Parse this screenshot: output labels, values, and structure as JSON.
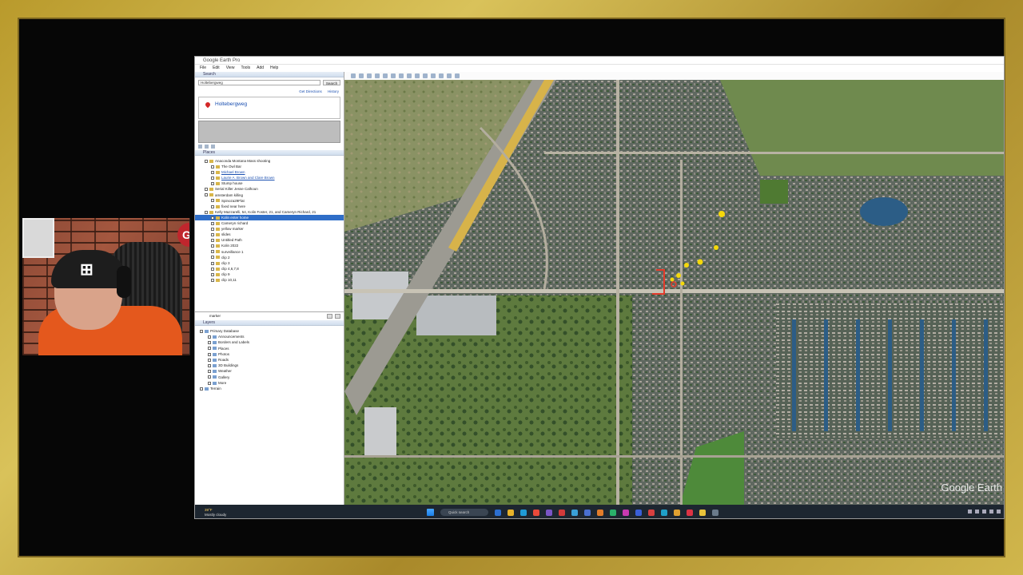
{
  "window": {
    "title": "Google Earth Pro",
    "menu": [
      "File",
      "Edit",
      "View",
      "Tools",
      "Add",
      "Help"
    ]
  },
  "search": {
    "header": "Search",
    "query": "Holtebergweg",
    "button": "Search",
    "get_directions": "Get Directions",
    "history": "History",
    "result": "Holtebergweg"
  },
  "places": {
    "header": "Places",
    "items": [
      {
        "label": "Anaconda Montana Mass shooting",
        "style": "",
        "indent": 1
      },
      {
        "label": "The Owl Bar",
        "style": "",
        "indent": 2
      },
      {
        "label": "Michael Brown",
        "style": "link",
        "indent": 2
      },
      {
        "label": "Laurie A. Brown and Clare Brown",
        "style": "link",
        "indent": 2
      },
      {
        "label": "Stump house",
        "style": "",
        "indent": 2
      },
      {
        "label": "Serial Killer Jesse Calhoun",
        "style": "",
        "indent": 1
      },
      {
        "label": "amsterdam killing",
        "style": "",
        "indent": 1
      },
      {
        "label": "Spinoza29Flat",
        "style": "",
        "indent": 2
      },
      {
        "label": "fixed near here",
        "style": "",
        "indent": 2
      },
      {
        "label": "Kelly Mazzarelli, 54, Kolin Foster, 21, and Cameryn Richard, 21",
        "style": "",
        "indent": 1
      },
      {
        "label": "Kolin enter home",
        "style": "selected",
        "indent": 2
      },
      {
        "label": "Cameryn richard",
        "style": "",
        "indent": 2
      },
      {
        "label": "yellow marker",
        "style": "",
        "indent": 2
      },
      {
        "label": "slides",
        "style": "",
        "indent": 2
      },
      {
        "label": "Untitled Path",
        "style": "",
        "indent": 2
      },
      {
        "label": "Kolin 2022",
        "style": "",
        "indent": 2
      },
      {
        "label": "surveillance 1",
        "style": "",
        "indent": 2
      },
      {
        "label": "clip 2",
        "style": "",
        "indent": 2
      },
      {
        "label": "clip 3",
        "style": "",
        "indent": 2
      },
      {
        "label": "clip 4,6,7,8",
        "style": "",
        "indent": 2
      },
      {
        "label": "clip 9",
        "style": "",
        "indent": 2
      },
      {
        "label": "clip 10,11",
        "style": "",
        "indent": 2
      }
    ],
    "footer_value": "marker"
  },
  "layers": {
    "header": "Layers",
    "items": [
      {
        "label": "Primary Database",
        "indent": 0
      },
      {
        "label": "Announcements",
        "indent": 1
      },
      {
        "label": "Borders and Labels",
        "indent": 1
      },
      {
        "label": "Places",
        "indent": 1
      },
      {
        "label": "Photos",
        "indent": 1
      },
      {
        "label": "Roads",
        "indent": 1
      },
      {
        "label": "3D Buildings",
        "indent": 1
      },
      {
        "label": "Weather",
        "indent": 1
      },
      {
        "label": "Gallery",
        "indent": 1
      },
      {
        "label": "More",
        "indent": 1
      },
      {
        "label": "Terrain",
        "indent": 0
      }
    ]
  },
  "map": {
    "attribution": "Google Earth",
    "colors": {
      "marker": "#f5d90a",
      "path": "#e23a2a"
    }
  },
  "taskbar": {
    "temp": "39°F",
    "weather": "Mostly cloudy",
    "search_placeholder": "Quick search"
  },
  "webcam": {
    "badge": "GK"
  }
}
